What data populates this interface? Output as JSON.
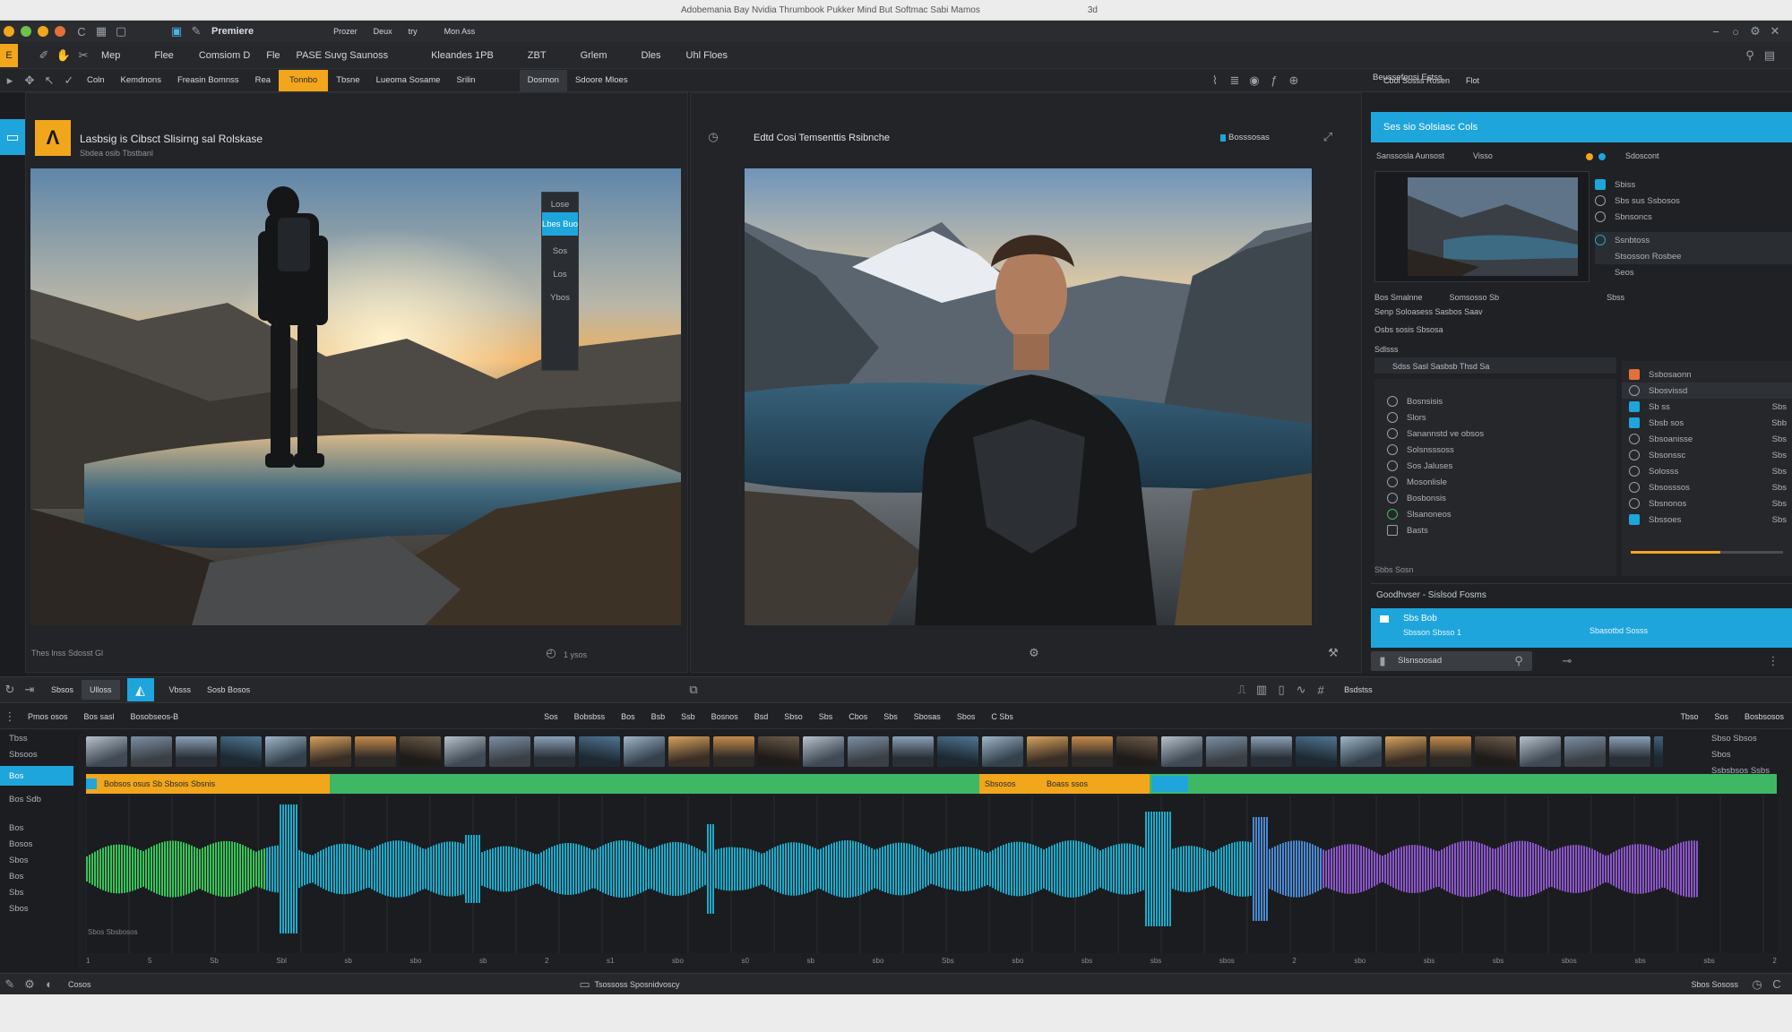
{
  "window": {
    "app_name": "Premiere",
    "title_text": "Adobemania Bay Nvidia Thrumbook Pukker Mind But Softmac Sabi Mamos",
    "title_tail": "3d"
  },
  "menubar": [
    "Prozer",
    "Deux",
    "try",
    "Mon Ass"
  ],
  "toolbar1": [
    "Mep",
    "Flee",
    "Comsiom D",
    "Fle",
    "PASE Suvg Saunoss",
    "Kleandes 1PB",
    "ZBT",
    "Grlem",
    "Dles",
    "Uhl Floes"
  ],
  "toolbar2": {
    "items": [
      "Coln",
      "Kemdnons",
      "Freasin Bomnss",
      "Rea",
      "Tonnbo",
      "Tbsne",
      "Lueoma Sosame",
      "Srilin",
      "Dosmon",
      "Sdoore Mloes"
    ],
    "active_index": 4,
    "right_items": [
      "Cbol Sosss Rosen",
      "Flot"
    ]
  },
  "source_monitor": {
    "logo_letter": "Λ",
    "title": "Lasbsig is Cibsct Slisirng sal Rolskase",
    "subtitle": "Sbdea osib Tbstbanl",
    "footer_left": "Thes lnss Sdosst Gl",
    "footer_mid": "1 ysos",
    "side_buttons": [
      "Lose",
      "Lbes Buo",
      "Sos",
      "Los",
      "Ybos"
    ]
  },
  "program_monitor": {
    "title": "Edtd Cosi Temsenttis Rsibnche",
    "btn_label": "Bosssosas"
  },
  "inspector": {
    "panel_title": "Beussefonsi Estss",
    "header": "Ses sio Solsiasc Cols",
    "sub_left": "Sanssosla Aunsost",
    "sub_right": "Visso",
    "right_header": "Sdoscont",
    "mini_rows": [
      "Sbiss",
      "Sbs sus Ssbosos",
      "Sbnsoncs"
    ],
    "mini_rows2": [
      "Ssnbtoss",
      "Stsosson Rosbee",
      "Seos"
    ],
    "tabs": [
      "Bos Smalnne",
      "Somsosso Sb",
      "Sbss"
    ],
    "lines": [
      "Senp Soloasess Sasbos Saav",
      "Osbs sosis Sbsosa",
      "Sdlsss"
    ],
    "layer_header": "Sdss Sasl Sasbsb Thsd Sa",
    "layers": [
      "Bosnsisis",
      "Slors",
      "Sanannstd ve obsos",
      "Solsnsssoss",
      "Sos Jaluses",
      "Mosonlisle",
      "Bosbonsis",
      "Slsanoneos",
      "Basts"
    ],
    "props": [
      "Ssbosaonn",
      "Sbosvissd",
      "Sb ss",
      "Sbsb sos",
      "Sbsoanisse",
      "Sbsonssc",
      "Solosss",
      "Sbsosssos",
      "Sbsnonos",
      "Sbssoes"
    ],
    "props_values": [
      "Sbs",
      "Sbs",
      "Sbs",
      "Sbb",
      "Sbs",
      "Sbs",
      "Sbs",
      "Sbs",
      "Sbs",
      "Sbs"
    ],
    "footer": "Sbbs Sosn",
    "section2_title": "Goodhvser - Sislsod Fosms",
    "banner_title": "Sbs Bob",
    "banner_sub": "Sbsson Sbsso 1",
    "banner_right": "Sbasotbd Sosss",
    "input_value": "Slsnsoosad"
  },
  "transport": {
    "left_items": [
      "Sbsos",
      "Ulloss",
      "Vbsss",
      "Sosb Bosos"
    ],
    "right_label": "Bsdstss"
  },
  "timeline": {
    "header_items": [
      "Pmos osos",
      "Bos sasl",
      "Bosobseos-B"
    ],
    "center_items": [
      "Sos",
      "Bobsbss",
      "Bos",
      "Bsb",
      "Ssb",
      "Bosnos",
      "Bsd",
      "Sbso",
      "Sbs",
      "Cbos",
      "Sbs",
      "Sbosas",
      "Sbos",
      "C Sbs"
    ],
    "right_items": [
      "Tbso",
      "Sos",
      "Bosbsosos"
    ],
    "clip_labels": [
      "Bobsos osus Sb Sbsois Sbsnis",
      "Sbsosos",
      "Boass ssos"
    ],
    "ruler_labels": [
      "1",
      "5",
      "Sb",
      "Sbl",
      "sb",
      "sbo",
      "sb",
      "2",
      "s1",
      "sbo",
      "s0",
      "sb",
      "sbo",
      "Sbs",
      "sbo",
      "sbs",
      "sbs",
      "sbos",
      "2",
      "sbo",
      "sbs",
      "sbs",
      "sbos",
      "sbs",
      "sbs",
      "2"
    ],
    "track_labels": [
      "Tbss",
      "Sbsoos",
      "Bos",
      "Bos Sdb",
      "Bos",
      "Bosos",
      "Sbos",
      "Bos",
      "Sbs",
      "Sbos"
    ],
    "right_col": [
      "Sbso Sbsos",
      "Sbos",
      "Ssbsbsos Ssbs"
    ],
    "audio_label": "Sbos Sbsbosos"
  },
  "statusbar": {
    "left": "Cosos",
    "center": "Tsossoss Sposnidvoscy",
    "right": "Sbos Sososs"
  },
  "colors": {
    "accent_blue": "#1ea5dc",
    "accent_orange": "#f2a61c",
    "clip_green": "#3fb866",
    "wave_green": "#38c45a",
    "wave_cyan": "#1ea9c9",
    "wave_purple": "#8a55c9"
  }
}
